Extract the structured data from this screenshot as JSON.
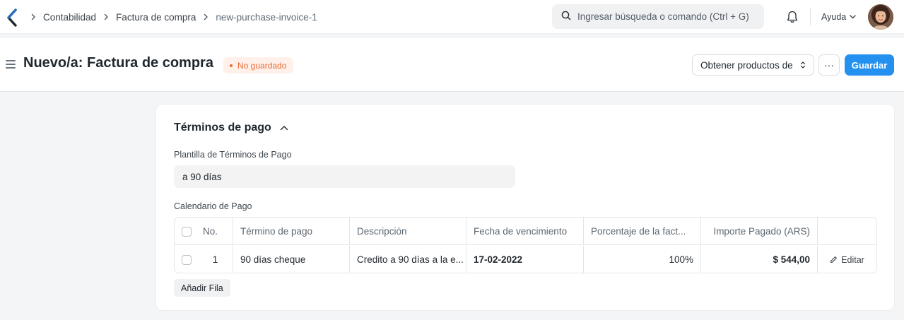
{
  "navbar": {
    "breadcrumbs": [
      "Contabilidad",
      "Factura de compra",
      "new-purchase-invoice-1"
    ],
    "search_placeholder": "Ingresar búsqueda o comando (Ctrl + G)",
    "help_label": "Ayuda"
  },
  "page_head": {
    "title": "Nuevo/a: Factura de compra",
    "status_badge": "No guardado",
    "get_items_label": "Obtener productos de",
    "more_label": "···",
    "save_label": "Guardar"
  },
  "section": {
    "title": "Términos de pago",
    "template_label": "Plantilla de Términos de Pago",
    "template_value": "a 90 días",
    "schedule_label": "Calendario de Pago",
    "add_row_label": "Añadir Fila"
  },
  "schedule": {
    "columns": [
      "No.",
      "Término de pago",
      "Descripción",
      "Fecha de vencimiento",
      "Porcentaje de la fact...",
      "Importe Pagado (ARS)"
    ],
    "rows": [
      {
        "no": "1",
        "term": "90 días cheque",
        "description": "Credito a 90 días a la e...",
        "due_date": "17-02-2022",
        "percentage": "100%",
        "amount": "$ 544,00",
        "edit_label": "Editar"
      }
    ]
  },
  "colors": {
    "primary": "#2490ef",
    "warning": "#e86c37",
    "warning_bg": "#fff1ea",
    "logo": "#2a6ec0"
  }
}
